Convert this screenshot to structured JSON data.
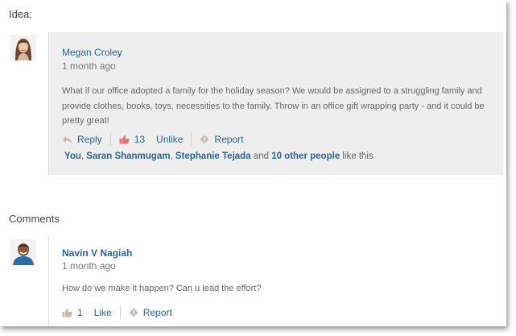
{
  "idea": {
    "section_title": "Idea:",
    "author": "Megan Croley",
    "time": "1 month ago",
    "text": "What if our office adopted a family for the holiday season? We would be assigned to a struggling family and provide clothes, books, toys, necessities to the family. Throw in an office gift wrapping party - and it could be pretty great!",
    "actions": {
      "reply": "Reply",
      "like_count": "13",
      "unlike": "Unlike",
      "report": "Report"
    },
    "likers": {
      "you": "You",
      "sep1": ",",
      "person1": "Saran Shanmugam",
      "sep2": ",",
      "person2": "Stephanie Tejada",
      "and": "and",
      "others": "10 other people",
      "suffix": "like this"
    },
    "like_icon_color": "#e57373"
  },
  "comments": {
    "section_title": "Comments",
    "items": [
      {
        "author": "Navin V Nagiah",
        "time": "1 month ago",
        "text": "How do we make it happen? Can u lead the effort?",
        "like_count": "1",
        "like": "Like",
        "report": "Report"
      }
    ]
  },
  "colors": {
    "link": "#2a6496",
    "idea_background": "#eeeeee",
    "muted_icon": "#c8b8a8"
  }
}
